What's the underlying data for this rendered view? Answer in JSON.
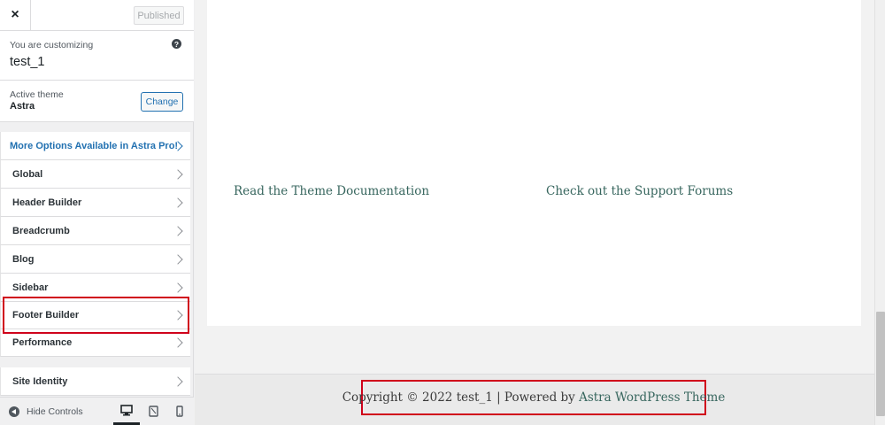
{
  "topbar": {
    "close_icon": "×",
    "publish_label": "Published"
  },
  "info": {
    "pre": "You are customizing",
    "title": "test_1",
    "help": "?"
  },
  "theme": {
    "label": "Active theme",
    "name": "Astra",
    "change_label": "Change"
  },
  "promo": {
    "label": "More Options Available in Astra Pro!"
  },
  "sections": [
    "Global",
    "Header Builder",
    "Breadcrumb",
    "Blog",
    "Sidebar",
    "Footer Builder",
    "Performance",
    "Site Identity"
  ],
  "bottom": {
    "hide_label": "Hide Controls"
  },
  "preview": {
    "link_docs": "Read the Theme Documentation",
    "link_forums": "Check out the Support Forums",
    "copyright_text": "Copyright © 2022 test_1 | Powered by ",
    "copyright_link": "Astra WordPress Theme"
  },
  "colors": {
    "accent": "#2271b1",
    "highlight": "#d0021b",
    "link": "#37665e"
  }
}
